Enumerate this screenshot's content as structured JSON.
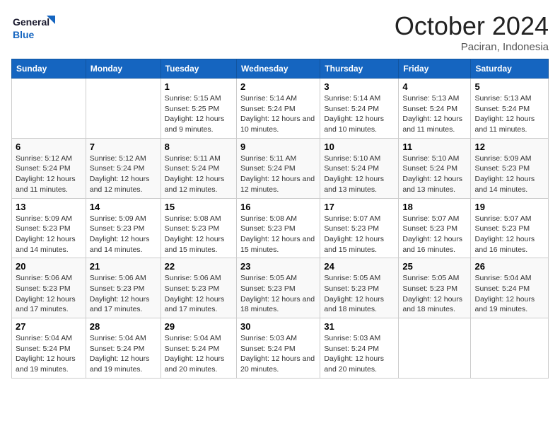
{
  "header": {
    "logo_line1": "General",
    "logo_line2": "Blue",
    "month": "October 2024",
    "location": "Paciran, Indonesia"
  },
  "weekdays": [
    "Sunday",
    "Monday",
    "Tuesday",
    "Wednesday",
    "Thursday",
    "Friday",
    "Saturday"
  ],
  "weeks": [
    [
      {
        "day": "",
        "info": ""
      },
      {
        "day": "",
        "info": ""
      },
      {
        "day": "1",
        "info": "Sunrise: 5:15 AM\nSunset: 5:25 PM\nDaylight: 12 hours and 9 minutes."
      },
      {
        "day": "2",
        "info": "Sunrise: 5:14 AM\nSunset: 5:24 PM\nDaylight: 12 hours and 10 minutes."
      },
      {
        "day": "3",
        "info": "Sunrise: 5:14 AM\nSunset: 5:24 PM\nDaylight: 12 hours and 10 minutes."
      },
      {
        "day": "4",
        "info": "Sunrise: 5:13 AM\nSunset: 5:24 PM\nDaylight: 12 hours and 11 minutes."
      },
      {
        "day": "5",
        "info": "Sunrise: 5:13 AM\nSunset: 5:24 PM\nDaylight: 12 hours and 11 minutes."
      }
    ],
    [
      {
        "day": "6",
        "info": "Sunrise: 5:12 AM\nSunset: 5:24 PM\nDaylight: 12 hours and 11 minutes."
      },
      {
        "day": "7",
        "info": "Sunrise: 5:12 AM\nSunset: 5:24 PM\nDaylight: 12 hours and 12 minutes."
      },
      {
        "day": "8",
        "info": "Sunrise: 5:11 AM\nSunset: 5:24 PM\nDaylight: 12 hours and 12 minutes."
      },
      {
        "day": "9",
        "info": "Sunrise: 5:11 AM\nSunset: 5:24 PM\nDaylight: 12 hours and 12 minutes."
      },
      {
        "day": "10",
        "info": "Sunrise: 5:10 AM\nSunset: 5:24 PM\nDaylight: 12 hours and 13 minutes."
      },
      {
        "day": "11",
        "info": "Sunrise: 5:10 AM\nSunset: 5:24 PM\nDaylight: 12 hours and 13 minutes."
      },
      {
        "day": "12",
        "info": "Sunrise: 5:09 AM\nSunset: 5:23 PM\nDaylight: 12 hours and 14 minutes."
      }
    ],
    [
      {
        "day": "13",
        "info": "Sunrise: 5:09 AM\nSunset: 5:23 PM\nDaylight: 12 hours and 14 minutes."
      },
      {
        "day": "14",
        "info": "Sunrise: 5:09 AM\nSunset: 5:23 PM\nDaylight: 12 hours and 14 minutes."
      },
      {
        "day": "15",
        "info": "Sunrise: 5:08 AM\nSunset: 5:23 PM\nDaylight: 12 hours and 15 minutes."
      },
      {
        "day": "16",
        "info": "Sunrise: 5:08 AM\nSunset: 5:23 PM\nDaylight: 12 hours and 15 minutes."
      },
      {
        "day": "17",
        "info": "Sunrise: 5:07 AM\nSunset: 5:23 PM\nDaylight: 12 hours and 15 minutes."
      },
      {
        "day": "18",
        "info": "Sunrise: 5:07 AM\nSunset: 5:23 PM\nDaylight: 12 hours and 16 minutes."
      },
      {
        "day": "19",
        "info": "Sunrise: 5:07 AM\nSunset: 5:23 PM\nDaylight: 12 hours and 16 minutes."
      }
    ],
    [
      {
        "day": "20",
        "info": "Sunrise: 5:06 AM\nSunset: 5:23 PM\nDaylight: 12 hours and 17 minutes."
      },
      {
        "day": "21",
        "info": "Sunrise: 5:06 AM\nSunset: 5:23 PM\nDaylight: 12 hours and 17 minutes."
      },
      {
        "day": "22",
        "info": "Sunrise: 5:06 AM\nSunset: 5:23 PM\nDaylight: 12 hours and 17 minutes."
      },
      {
        "day": "23",
        "info": "Sunrise: 5:05 AM\nSunset: 5:23 PM\nDaylight: 12 hours and 18 minutes."
      },
      {
        "day": "24",
        "info": "Sunrise: 5:05 AM\nSunset: 5:23 PM\nDaylight: 12 hours and 18 minutes."
      },
      {
        "day": "25",
        "info": "Sunrise: 5:05 AM\nSunset: 5:23 PM\nDaylight: 12 hours and 18 minutes."
      },
      {
        "day": "26",
        "info": "Sunrise: 5:04 AM\nSunset: 5:24 PM\nDaylight: 12 hours and 19 minutes."
      }
    ],
    [
      {
        "day": "27",
        "info": "Sunrise: 5:04 AM\nSunset: 5:24 PM\nDaylight: 12 hours and 19 minutes."
      },
      {
        "day": "28",
        "info": "Sunrise: 5:04 AM\nSunset: 5:24 PM\nDaylight: 12 hours and 19 minutes."
      },
      {
        "day": "29",
        "info": "Sunrise: 5:04 AM\nSunset: 5:24 PM\nDaylight: 12 hours and 20 minutes."
      },
      {
        "day": "30",
        "info": "Sunrise: 5:03 AM\nSunset: 5:24 PM\nDaylight: 12 hours and 20 minutes."
      },
      {
        "day": "31",
        "info": "Sunrise: 5:03 AM\nSunset: 5:24 PM\nDaylight: 12 hours and 20 minutes."
      },
      {
        "day": "",
        "info": ""
      },
      {
        "day": "",
        "info": ""
      }
    ]
  ]
}
